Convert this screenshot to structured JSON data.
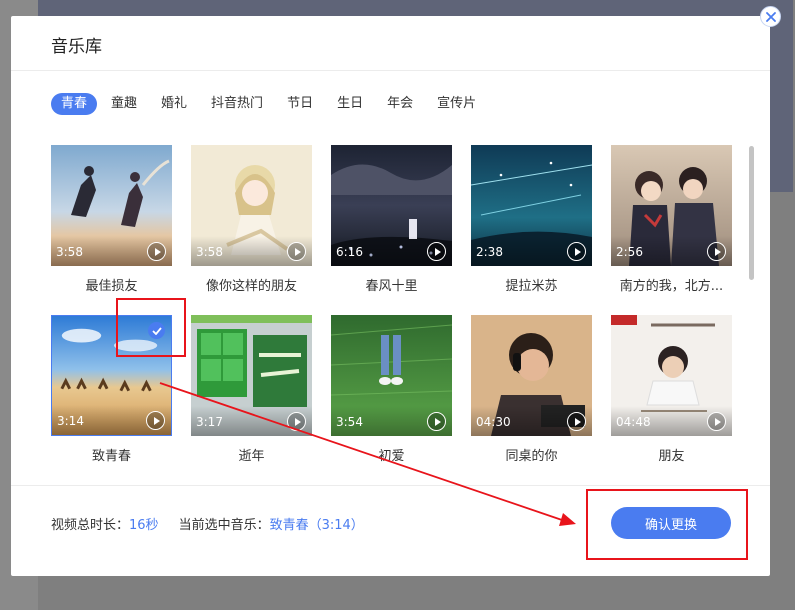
{
  "dialog": {
    "title": "音乐库"
  },
  "tabs": [
    {
      "label": "青春",
      "active": true
    },
    {
      "label": "童趣"
    },
    {
      "label": "婚礼"
    },
    {
      "label": "抖音热门"
    },
    {
      "label": "节日"
    },
    {
      "label": "生日"
    },
    {
      "label": "年会"
    },
    {
      "label": "宣传片"
    }
  ],
  "songs": [
    {
      "name": "最佳损友",
      "duration": "3:58",
      "icon": "play-icon"
    },
    {
      "name": "像你这样的朋友",
      "duration": "3:58",
      "icon": "play-icon"
    },
    {
      "name": "春风十里",
      "duration": "6:16",
      "icon": "play-icon"
    },
    {
      "name": "提拉米苏",
      "duration": "2:38",
      "icon": "play-icon"
    },
    {
      "name": "南方的我，北方...",
      "duration": "2:56",
      "icon": "play-icon"
    },
    {
      "name": "致青春",
      "duration": "3:14",
      "icon": "play-icon",
      "selected": true
    },
    {
      "name": "逝年",
      "duration": "3:17",
      "icon": "play-icon"
    },
    {
      "name": "初爱",
      "duration": "3:54",
      "icon": "play-icon"
    },
    {
      "name": "同桌的你",
      "duration": "04:30",
      "icon": "play-icon"
    },
    {
      "name": "朋友",
      "duration": "04:48",
      "icon": "play-icon"
    }
  ],
  "footer": {
    "duration_label": "视频总时长：",
    "duration_value": "16秒",
    "current_label": "当前选中音乐：",
    "current_value": "致青春（3:14）",
    "confirm_label": "确认更换"
  },
  "colors": {
    "accent": "#4a7cf0",
    "annotation": "#e8141b"
  }
}
